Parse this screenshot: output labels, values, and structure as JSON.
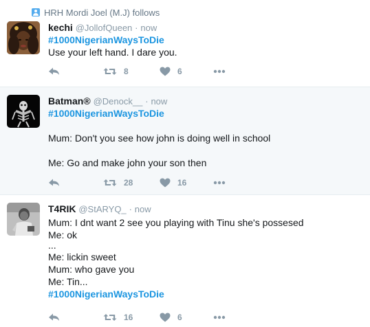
{
  "context": {
    "label": "HRH Mordi Joel (M.J) follows",
    "icon": "person-follow-icon"
  },
  "tweets": [
    {
      "fullname": "kechi",
      "handle": "@JollofQueen",
      "separator": "·",
      "time": "now",
      "lines": [
        "#1000NigerianWaysToDie",
        "Use your left hand. I dare you."
      ],
      "retweets": "8",
      "likes": "6"
    },
    {
      "fullname": "Batman®",
      "handle": "@Denock__",
      "separator": "·",
      "time": "now",
      "lines": [
        "#1000NigerianWaysToDie",
        "",
        "Mum: Don't you see how john is doing well in school",
        "",
        "Me: Go and make john your son then"
      ],
      "retweets": "28",
      "likes": "16"
    },
    {
      "fullname": "T4RIK",
      "handle": "@StARYQ_",
      "separator": "·",
      "time": "now",
      "lines": [
        "Mum: I dnt want 2 see you playing with Tinu she's possesed",
        "Me: ok",
        "...",
        "Me: lickin sweet",
        "Mum: who gave you",
        "Me: Tin...",
        "#1000NigerianWaysToDie"
      ],
      "retweets": "16",
      "likes": "6"
    }
  ],
  "icons": {
    "reply": "reply-icon",
    "retweet": "retweet-icon",
    "like": "heart-icon",
    "more": "more-icon"
  },
  "colors": {
    "hashtag": "#1b95e0",
    "muted": "#8899a6",
    "highlight_bg": "#f5f8fa",
    "follow_icon": "#55acee"
  }
}
